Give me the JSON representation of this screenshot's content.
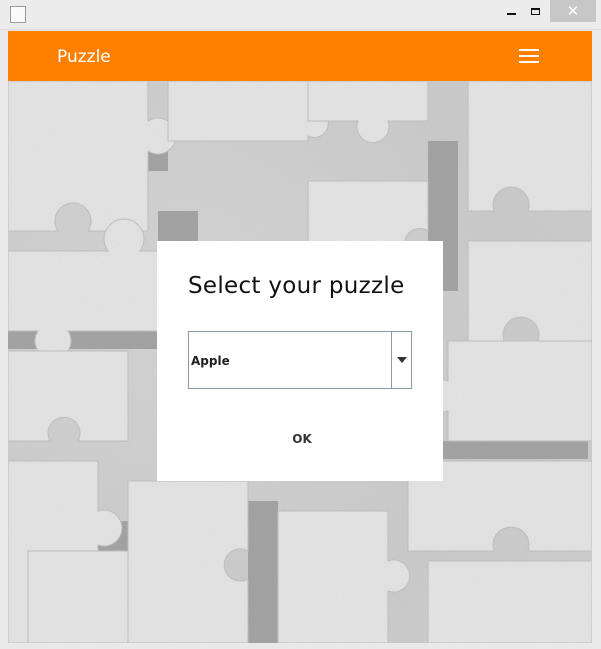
{
  "window": {
    "min_icon": "minimize-icon",
    "max_icon": "maximize-icon",
    "close_glyph": "✕",
    "app_icon": "java-icon"
  },
  "header": {
    "title": "Puzzle",
    "menu_icon": "hamburger-menu-icon",
    "color": "#ff8000"
  },
  "dialog": {
    "title": "Select your puzzle",
    "combo_value": "Apple",
    "ok_label": "OK"
  },
  "background": {
    "description_icon": "puzzle-pieces-background"
  }
}
